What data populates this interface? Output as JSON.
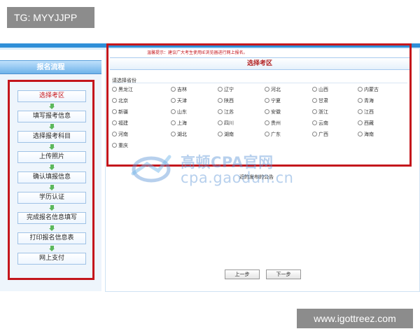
{
  "overlay": {
    "tag_label": "TG: MYYJJPP",
    "site_label": "www.igottreez.com"
  },
  "sidebar": {
    "title": "报名流程",
    "steps": [
      {
        "label": "选择考区",
        "active": true
      },
      {
        "label": "填写报考信息",
        "active": false
      },
      {
        "label": "选择报考科目",
        "active": false
      },
      {
        "label": "上传照片",
        "active": false
      },
      {
        "label": "确认填报信息",
        "active": false
      },
      {
        "label": "学历认证",
        "active": false
      },
      {
        "label": "完成报名信息填写",
        "active": false
      },
      {
        "label": "打印报名信息表",
        "active": false
      },
      {
        "label": "网上支付",
        "active": false
      }
    ]
  },
  "main": {
    "notice": "温馨提示：建议广大考生使用IE浏览器进行网上报名。",
    "title": "选择考区",
    "section_label": "请选择省份",
    "provinces": [
      [
        "黑龙江",
        "吉林",
        "辽宁",
        "河北",
        "山西",
        "内蒙古"
      ],
      [
        "北京",
        "天津",
        "陕西",
        "宁夏",
        "甘肃",
        "青海"
      ],
      [
        "新疆",
        "山东",
        "江苏",
        "安徽",
        "浙江",
        "江西"
      ],
      [
        "福建",
        "上海",
        "四川",
        "贵州",
        "云南",
        "西藏"
      ],
      [
        "河南",
        "湖北",
        "湖南",
        "广东",
        "广西",
        "海南"
      ],
      [
        "重庆"
      ]
    ],
    "announcement": "近的发布的公告",
    "prev_button": "上一步",
    "next_button": "下一步"
  },
  "watermark": {
    "title": "高顿CPA官网",
    "subtitle": "cpa.gaodun.cn"
  },
  "colors": {
    "accent_blue": "#2f8fd8",
    "highlight_red": "#c4161c"
  }
}
